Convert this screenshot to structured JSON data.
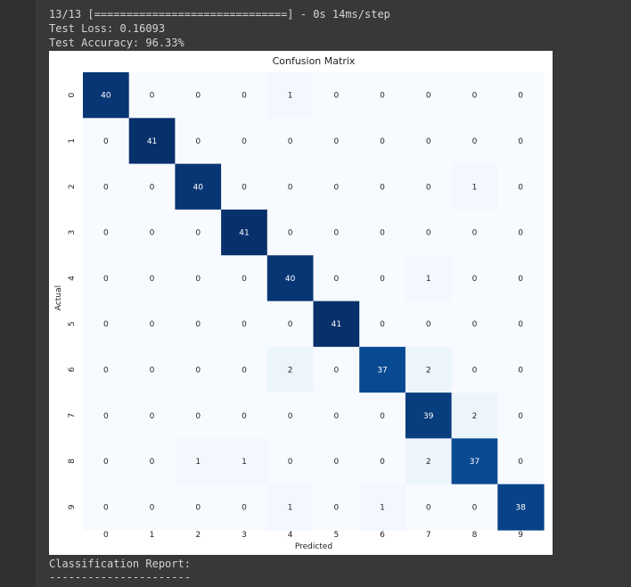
{
  "output": {
    "progress_line": "13/13 [==============================] - 0s 14ms/step",
    "loss_line": "Test Loss: 0.16093",
    "accuracy_line": "Test Accuracy: 96.33%",
    "report_title": "Classification Report:",
    "report_divider": "----------------------"
  },
  "colors": {
    "background": "#383838",
    "text": "#d4d4d4",
    "cmap_low": "#f7fbff",
    "cmap_high": "#08306b"
  },
  "chart_data": {
    "type": "heatmap",
    "title": "Confusion Matrix",
    "xlabel": "Predicted",
    "ylabel": "Actual",
    "x_ticks": [
      "0",
      "1",
      "2",
      "3",
      "4",
      "5",
      "6",
      "7",
      "8",
      "9"
    ],
    "y_ticks": [
      "0",
      "1",
      "2",
      "3",
      "4",
      "5",
      "6",
      "7",
      "8",
      "9"
    ],
    "colormap": "Blues",
    "colorbar": false,
    "annotated": true,
    "values": [
      [
        40,
        0,
        0,
        0,
        1,
        0,
        0,
        0,
        0,
        0
      ],
      [
        0,
        41,
        0,
        0,
        0,
        0,
        0,
        0,
        0,
        0
      ],
      [
        0,
        0,
        40,
        0,
        0,
        0,
        0,
        0,
        1,
        0
      ],
      [
        0,
        0,
        0,
        41,
        0,
        0,
        0,
        0,
        0,
        0
      ],
      [
        0,
        0,
        0,
        0,
        40,
        0,
        0,
        1,
        0,
        0
      ],
      [
        0,
        0,
        0,
        0,
        0,
        41,
        0,
        0,
        0,
        0
      ],
      [
        0,
        0,
        0,
        0,
        2,
        0,
        37,
        2,
        0,
        0
      ],
      [
        0,
        0,
        0,
        0,
        0,
        0,
        0,
        39,
        2,
        0
      ],
      [
        0,
        0,
        1,
        1,
        0,
        0,
        0,
        2,
        37,
        0
      ],
      [
        0,
        0,
        0,
        0,
        1,
        0,
        1,
        0,
        0,
        38
      ]
    ]
  }
}
